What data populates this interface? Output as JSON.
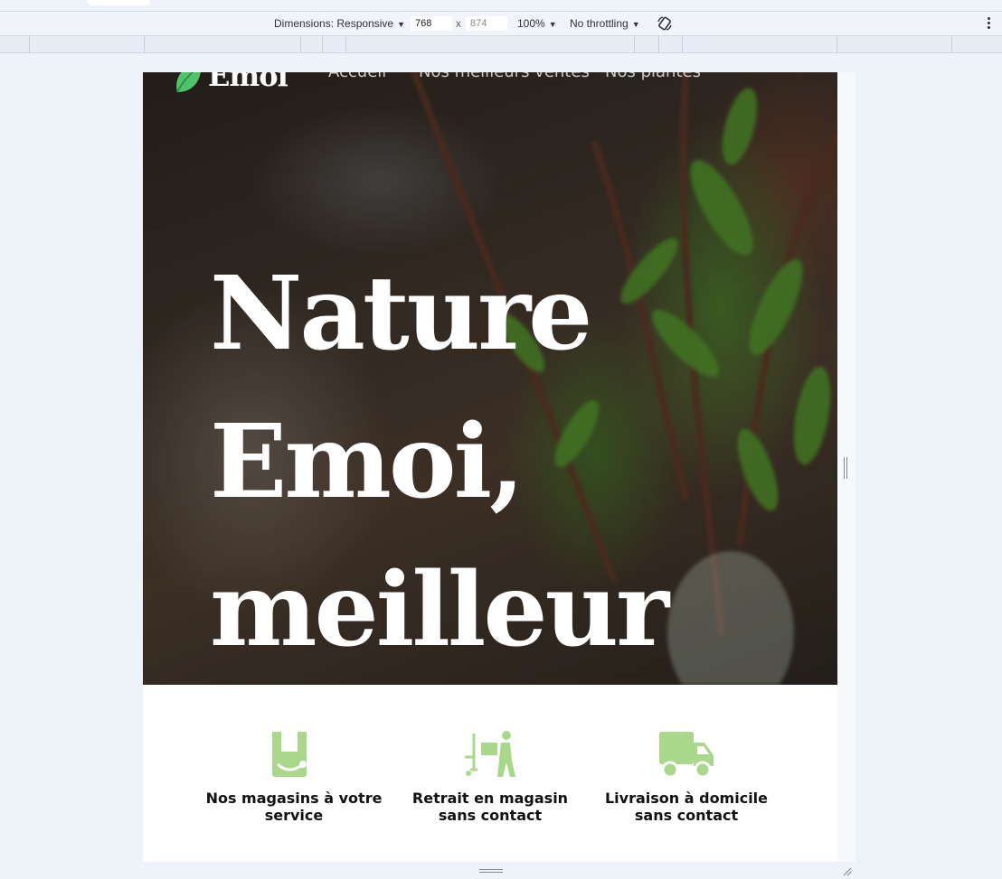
{
  "device_toolbar": {
    "dimensions_label": "Dimensions: Responsive",
    "width_value": "768",
    "times": "x",
    "height_value": "874",
    "zoom": "100%",
    "throttling": "No throttling"
  },
  "site": {
    "logo_text": "Emoi",
    "nav": [
      "Accueil",
      "Nos meilleurs ventes",
      "Nos plantes"
    ],
    "headline": [
      "Nature",
      "Emoi,",
      "meilleur"
    ]
  },
  "features": [
    {
      "label": "Nos magasins à votre service",
      "icon": "store-icon"
    },
    {
      "label": "Retrait en magasin sans contact",
      "icon": "pickup-person-icon"
    },
    {
      "label": "Livraison à domicile sans contact",
      "icon": "delivery-truck-icon"
    }
  ],
  "colors": {
    "accent_green": "#a9d88b",
    "logo_green": "#4fc36a",
    "toolbar_bg": "#f1f4fa",
    "page_bg": "#eef2f9"
  }
}
